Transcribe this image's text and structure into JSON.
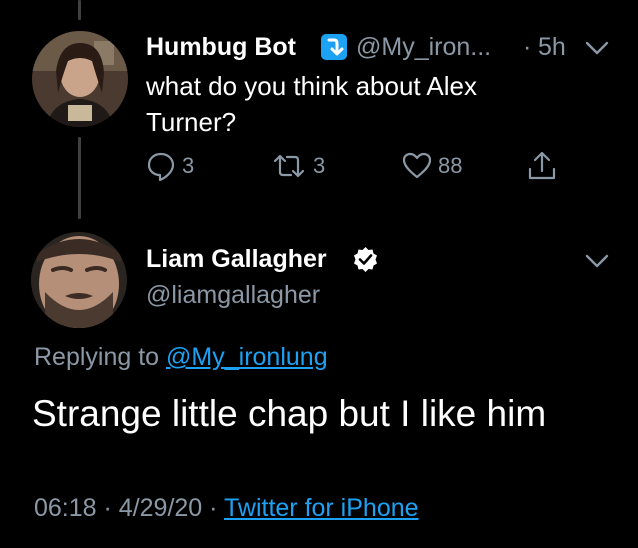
{
  "reply_tweet": {
    "display_name": "Humbug Bot",
    "handle": "@My_iron...",
    "separator": "·",
    "time": "5h",
    "text_line1": "what do you think about Alex",
    "text_line2": "Turner?",
    "actions": {
      "reply_count": "3",
      "retweet_count": "3",
      "like_count": "88"
    },
    "badge_icon": "arrow-down-right-badge-icon"
  },
  "main_tweet": {
    "display_name": "Liam Gallagher",
    "handle": "@liamgallagher",
    "verified_icon": "verified-badge-icon",
    "replying_prefix": "Replying to",
    "replying_handle": "@My_ironlung",
    "text": "Strange little chap but I like him",
    "time": "06:18",
    "separator1": "·",
    "date": "4/29/20",
    "separator2": "·",
    "source": "Twitter for iPhone"
  },
  "colors": {
    "background": "#000000",
    "secondary_text": "#8b98a5",
    "link": "#1da1f2",
    "thread_line": "#3d4144",
    "badge": "#1da1f2"
  }
}
